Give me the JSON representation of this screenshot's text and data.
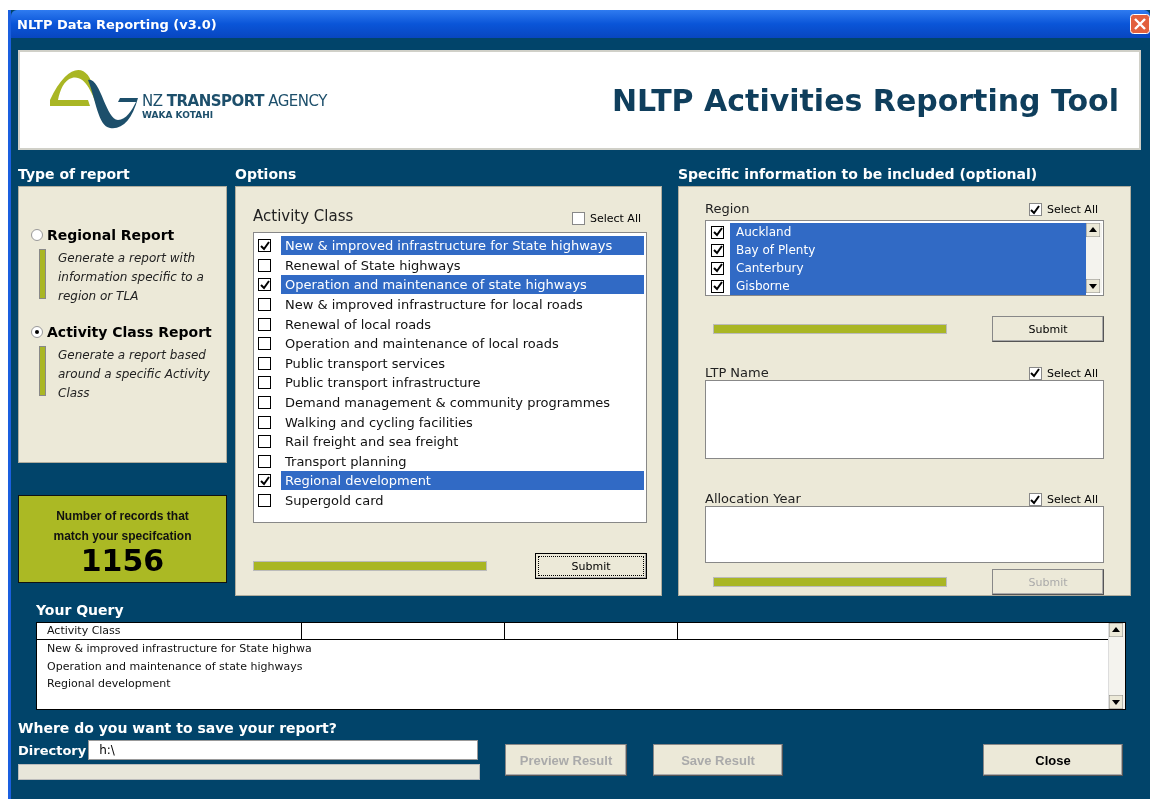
{
  "window": {
    "title": "NLTP Data Reporting (v3.0)"
  },
  "header": {
    "logo_name": "NZ **TRANSPORT** AGENCY",
    "logo_subtitle": "WAKA KOTAHI",
    "app_title": "NLTP Activities Reporting Tool"
  },
  "report_type": {
    "heading": "Type of report",
    "options": [
      {
        "label": "Regional Report",
        "description": "Generate a report with information specific to a region or TLA",
        "selected": false
      },
      {
        "label": "Activity Class Report",
        "description": "Generate a report based around a specific Activity Class",
        "selected": true
      }
    ]
  },
  "record_count": {
    "label": "Number of records that match your specifcation",
    "value": "1156"
  },
  "options": {
    "heading": "Options",
    "title": "Activity Class",
    "select_all": {
      "label": "Select All",
      "checked": false
    },
    "items": [
      {
        "label": "New & improved infrastructure for State highways",
        "checked": true,
        "selected": true
      },
      {
        "label": "Renewal of State highways",
        "checked": false,
        "selected": false
      },
      {
        "label": "Operation and maintenance of state highways",
        "checked": true,
        "selected": true
      },
      {
        "label": "New & improved infrastructure for local roads",
        "checked": false,
        "selected": false
      },
      {
        "label": "Renewal of local roads",
        "checked": false,
        "selected": false
      },
      {
        "label": "Operation and maintenance of local roads",
        "checked": false,
        "selected": false
      },
      {
        "label": "Public transport services",
        "checked": false,
        "selected": false
      },
      {
        "label": "Public transport infrastructure",
        "checked": false,
        "selected": false
      },
      {
        "label": "Demand management & community programmes",
        "checked": false,
        "selected": false
      },
      {
        "label": "Walking and cycling facilities",
        "checked": false,
        "selected": false
      },
      {
        "label": "Rail freight and sea freight",
        "checked": false,
        "selected": false
      },
      {
        "label": "Transport planning",
        "checked": false,
        "selected": false
      },
      {
        "label": "Regional development",
        "checked": true,
        "selected": true
      },
      {
        "label": "Supergold card",
        "checked": false,
        "selected": false
      }
    ],
    "progress": {
      "level": 1
    },
    "submit": {
      "label": "Submit",
      "disabled": false,
      "focused": true
    }
  },
  "specific": {
    "heading": "Specific information to be included (optional)",
    "region": {
      "title": "Region",
      "select_all": {
        "label": "Select All",
        "checked": true
      },
      "items": [
        {
          "label": "Auckland",
          "checked": true,
          "selected": true
        },
        {
          "label": "Bay of Plenty",
          "checked": true,
          "selected": true
        },
        {
          "label": "Canterbury",
          "checked": true,
          "selected": true
        },
        {
          "label": "Gisborne",
          "checked": true,
          "selected": true
        }
      ],
      "progress": {
        "level": 1
      },
      "submit": {
        "label": "Submit",
        "disabled": false
      }
    },
    "ltp_name": {
      "title": "LTP Name",
      "select_all": {
        "label": "Select All",
        "checked": true
      }
    },
    "allocation_year": {
      "title": "Allocation Year",
      "select_all": {
        "label": "Select All",
        "checked": true
      },
      "progress": {
        "level": 1
      },
      "submit": {
        "label": "Submit",
        "disabled": true
      }
    }
  },
  "query": {
    "heading": "Your Query",
    "columns": [
      "Activity Class"
    ],
    "rows": [
      "New & improved infrastructure for State highwa",
      "Operation and maintenance of state highways",
      "Regional development"
    ]
  },
  "save": {
    "heading": "Where do you want to save your report?",
    "directory": {
      "label": "Directory",
      "value": "h:\\"
    },
    "progress": {
      "level": 0
    },
    "buttons": [
      {
        "label": "Preview Result",
        "disabled": true
      },
      {
        "label": "Save Result",
        "disabled": true
      },
      {
        "label": "Close",
        "disabled": false
      }
    ]
  }
}
